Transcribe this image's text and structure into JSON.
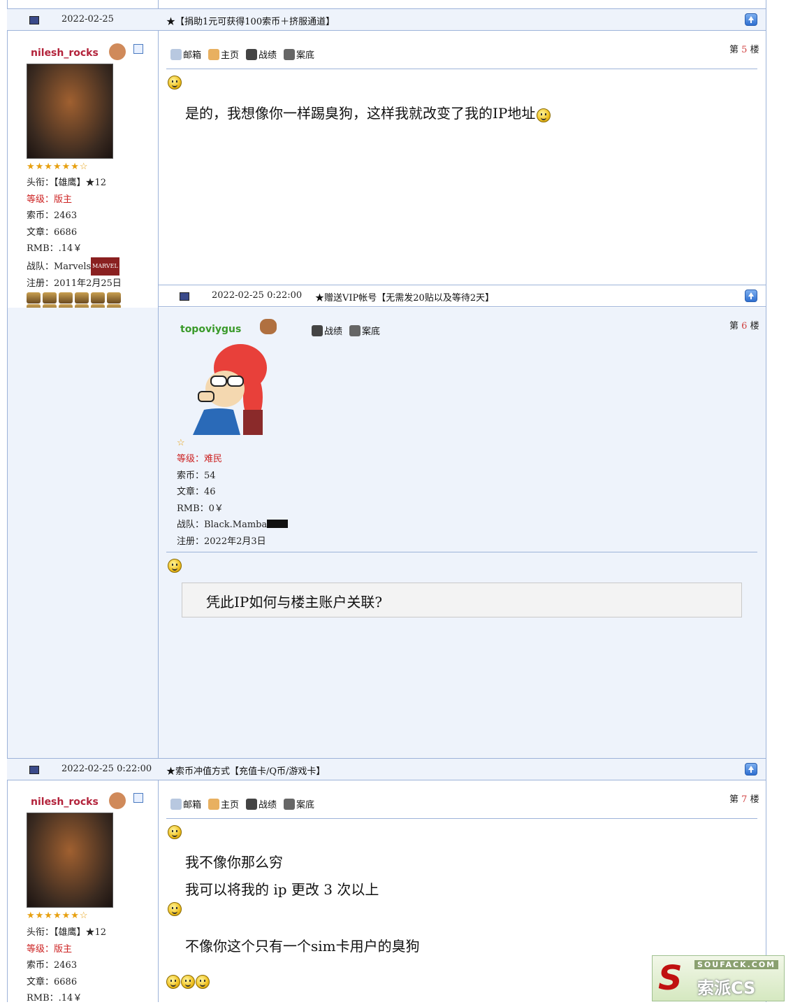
{
  "post5": {
    "bar_date": "2022-02-25",
    "bar_title": "★【捐助1元可获得100索币＋挤服通道】",
    "username": "nilesh_rocks",
    "stars": "★★★★★★☆",
    "title_label": "头衔：",
    "title_value": "【雄鹰】★12",
    "level_label": "等级：",
    "level_value": "版主",
    "coins": "索币：2463",
    "articles": "文章：6686",
    "rmb": "RMB：.14￥",
    "team": "战队：Marvels",
    "team_badge": "MARVEL",
    "register": "注册：2011年2月25日",
    "tools": [
      "邮箱",
      "主页",
      "战绩",
      "案底"
    ],
    "floor_prefix": "第",
    "floor_num": "5",
    "floor_suffix": "楼",
    "message": "是的，我想像你一样踢臭狗，这样我就改变了我的IP地址"
  },
  "post6": {
    "bar_date": "2022-02-25 0:22:00",
    "bar_title": "★赠送VIP帐号【无需发20贴以及等待2天】",
    "username": "topoviygus",
    "stars": "☆",
    "level_label": "等级：",
    "level_value": "难民",
    "coins": "索币：54",
    "articles": "文章：46",
    "rmb": "RMB：0￥",
    "team": "战队：Black.Mamba",
    "register": "注册：2022年2月3日",
    "tools": [
      "战绩",
      "案底"
    ],
    "floor_prefix": "第",
    "floor_num": "6",
    "floor_suffix": "楼",
    "quote": "凭此IP如何与楼主账户关联?"
  },
  "post7": {
    "bar_date": "2022-02-25 0:22:00",
    "bar_title": "★索币冲值方式【充值卡/Q币/游戏卡】",
    "username": "nilesh_rocks",
    "stars": "★★★★★★☆",
    "title_label": "头衔：",
    "title_value": "【雄鹰】★12",
    "level_label": "等级：",
    "level_value": "版主",
    "coins": "索币：2463",
    "articles": "文章：6686",
    "rmb": "RMB：.14￥",
    "tools": [
      "邮箱",
      "主页",
      "战绩",
      "案底"
    ],
    "floor_prefix": "第",
    "floor_num": "7",
    "floor_suffix": "楼",
    "line1": "我不像你那么穷",
    "line2": "我可以将我的 ip 更改 3 次以上",
    "line3": "不像你这个只有一个sim卡用户的臭狗"
  },
  "watermark": {
    "top": "SOUFACK.COM",
    "bottom": "索派CS"
  }
}
